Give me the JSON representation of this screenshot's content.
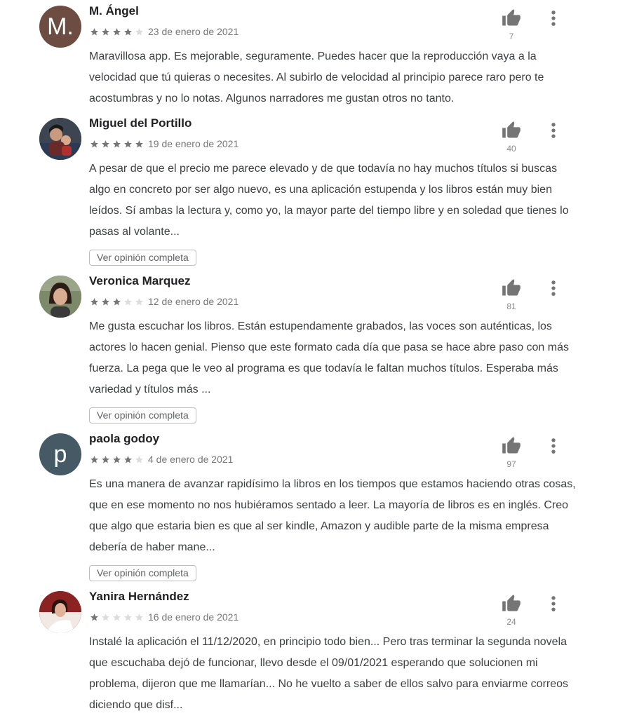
{
  "colors": {
    "star_filled": "#757575",
    "star_empty": "#dadce0",
    "thumb_icon": "#757575",
    "avatar_m": "#6d4c41",
    "avatar_p": "#455a64"
  },
  "icons": {
    "star": "star-icon",
    "thumb": "thumbs-up-icon",
    "menu": "more-vertical-icon"
  },
  "reviews": [
    {
      "avatar_letter": "M.",
      "author": "M. Ángel",
      "rating": 4,
      "date": "23 de enero de 2021",
      "likes": "7",
      "body": "Maravillosa app. Es mejorable, seguramente. Puedes hacer que la reproducción vaya a la velocidad que tú quieras o necesites. Al subirlo de velocidad al principio parece raro pero te acostumbras y no lo notas. Algunos narradores me gustan otros no tanto.",
      "more_label": ""
    },
    {
      "avatar_letter": "",
      "author": "Miguel del Portillo",
      "rating": 5,
      "date": "19 de enero de 2021",
      "likes": "40",
      "body": "A pesar de que el precio me parece elevado y de que todavía no hay muchos títulos si buscas algo en concreto por ser algo nuevo, es una aplicación estupenda y los libros están muy bien leídos. Sí ambas la lectura y, como yo, la mayor parte del tiempo libre y en soledad que tienes lo pasas al volante...",
      "more_label": "Ver opinión completa"
    },
    {
      "avatar_letter": "",
      "author": "Veronica Marquez",
      "rating": 3,
      "date": "12 de enero de 2021",
      "likes": "81",
      "body": "Me gusta escuchar los libros. Están estupendamente grabados, las voces son auténticas, los actores lo hacen genial. Pienso que este formato cada día que pasa se hace abre paso con más fuerza. La pega que le veo al programa es que todavía le faltan muchos títulos. Esperaba más variedad y títulos más ...",
      "more_label": "Ver opinión completa"
    },
    {
      "avatar_letter": "p",
      "author": "paola godoy",
      "rating": 4,
      "date": "4 de enero de 2021",
      "likes": "97",
      "body": "Es una manera de avanzar rapidísimo la libros en los tiempos que estamos haciendo otras cosas, que en ese momento no nos hubiéramos sentado a leer. La mayoría de libros es en inglés. Creo que algo que estaria bien es que al ser kindle, Amazon y audible parte de la misma empresa debería de haber mane...",
      "more_label": "Ver opinión completa"
    },
    {
      "avatar_letter": "",
      "author": "Yanira Hernández",
      "rating": 1,
      "date": "16 de enero de 2021",
      "likes": "24",
      "body": "Instalé la aplicación el 11/12/2020, en principio todo bien... Pero tras terminar la segunda novela que escuchaba dejó de funcionar, llevo desde el 09/01/2021 esperando que solucionen mi problema, dijeron que me llamarían... No he vuelto a saber de ellos salvo para enviarme correos diciendo que disf...",
      "more_label": ""
    }
  ]
}
